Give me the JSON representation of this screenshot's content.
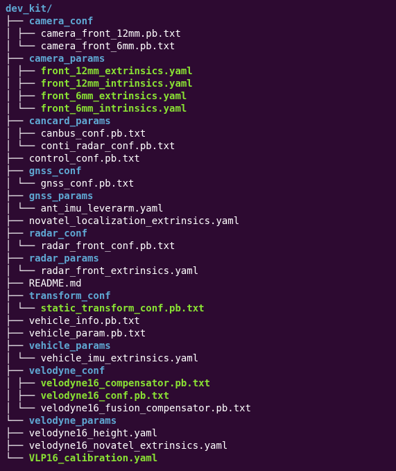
{
  "root": "dev_kit/",
  "items": [
    {
      "prefix": "├── ",
      "type": "dir",
      "name": "camera_conf"
    },
    {
      "prefix": "│   ├── ",
      "type": "file",
      "name": "camera_front_12mm.pb.txt"
    },
    {
      "prefix": "│   └── ",
      "type": "file",
      "name": "camera_front_6mm.pb.txt"
    },
    {
      "prefix": "├── ",
      "type": "dir",
      "name": "camera_params"
    },
    {
      "prefix": "│   ├── ",
      "type": "hl",
      "name": "front_12mm_extrinsics.yaml"
    },
    {
      "prefix": "│   ├── ",
      "type": "hl",
      "name": "front_12mm_intrinsics.yaml"
    },
    {
      "prefix": "│   ├── ",
      "type": "hl",
      "name": "front_6mm_extrinsics.yaml"
    },
    {
      "prefix": "│   └── ",
      "type": "hl",
      "name": "front_6mm_intrinsics.yaml"
    },
    {
      "prefix": "├── ",
      "type": "dir",
      "name": "cancard_params"
    },
    {
      "prefix": "│   ├── ",
      "type": "file",
      "name": "canbus_conf.pb.txt"
    },
    {
      "prefix": "│   └── ",
      "type": "file",
      "name": "conti_radar_conf.pb.txt"
    },
    {
      "prefix": "├── ",
      "type": "file",
      "name": "control_conf.pb.txt"
    },
    {
      "prefix": "├── ",
      "type": "dir",
      "name": "gnss_conf"
    },
    {
      "prefix": "│   └── ",
      "type": "file",
      "name": "gnss_conf.pb.txt"
    },
    {
      "prefix": "├── ",
      "type": "dir",
      "name": "gnss_params"
    },
    {
      "prefix": "│   └── ",
      "type": "file",
      "name": "ant_imu_leverarm.yaml"
    },
    {
      "prefix": "├── ",
      "type": "file",
      "name": "novatel_localization_extrinsics.yaml"
    },
    {
      "prefix": "├── ",
      "type": "dir",
      "name": "radar_conf"
    },
    {
      "prefix": "│   └── ",
      "type": "file",
      "name": "radar_front_conf.pb.txt"
    },
    {
      "prefix": "├── ",
      "type": "dir",
      "name": "radar_params"
    },
    {
      "prefix": "│   └── ",
      "type": "file",
      "name": "radar_front_extrinsics.yaml"
    },
    {
      "prefix": "├── ",
      "type": "file",
      "name": "README.md"
    },
    {
      "prefix": "├── ",
      "type": "dir",
      "name": "transform_conf"
    },
    {
      "prefix": "│   └── ",
      "type": "hl",
      "name": "static_transform_conf.pb.txt"
    },
    {
      "prefix": "├── ",
      "type": "file",
      "name": "vehicle_info.pb.txt"
    },
    {
      "prefix": "├── ",
      "type": "file",
      "name": "vehicle_param.pb.txt"
    },
    {
      "prefix": "├── ",
      "type": "dir",
      "name": "vehicle_params"
    },
    {
      "prefix": "│   └── ",
      "type": "file",
      "name": "vehicle_imu_extrinsics.yaml"
    },
    {
      "prefix": "├── ",
      "type": "dir",
      "name": "velodyne_conf"
    },
    {
      "prefix": "│   ├── ",
      "type": "hl",
      "name": "velodyne16_compensator.pb.txt"
    },
    {
      "prefix": "│   ├── ",
      "type": "hl",
      "name": "velodyne16_conf.pb.txt"
    },
    {
      "prefix": "│   └── ",
      "type": "file",
      "name": "velodyne16_fusion_compensator.pb.txt"
    },
    {
      "prefix": "└── ",
      "type": "dir",
      "name": "velodyne_params"
    },
    {
      "prefix": "    ├── ",
      "type": "file",
      "name": "velodyne16_height.yaml"
    },
    {
      "prefix": "    ├── ",
      "type": "file",
      "name": "velodyne16_novatel_extrinsics.yaml"
    },
    {
      "prefix": "    └── ",
      "type": "hl",
      "name": "VLP16_calibration.yaml"
    }
  ]
}
